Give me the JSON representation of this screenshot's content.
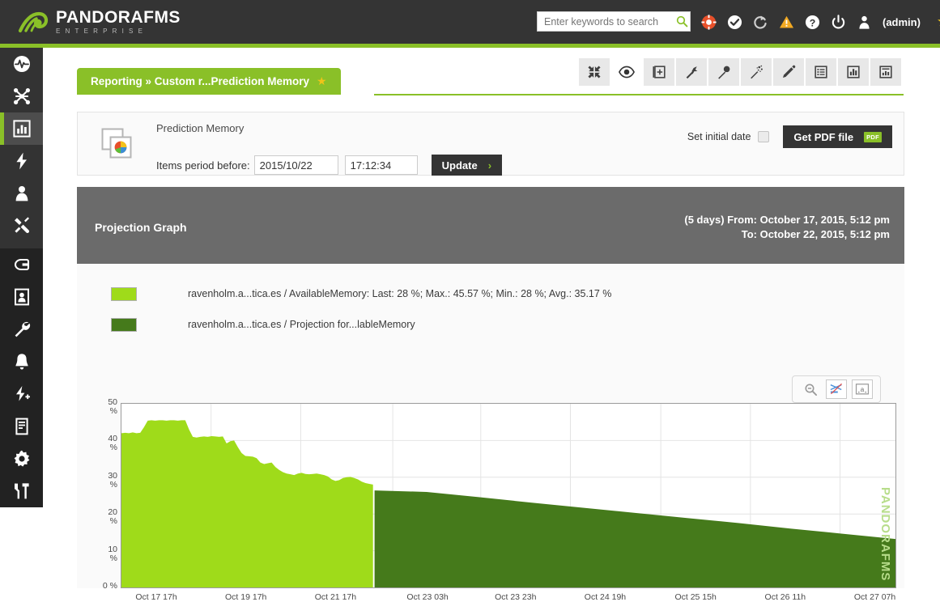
{
  "header": {
    "logo_title": "PANDORAFMS",
    "logo_sub": "ENTERPRISE",
    "logo_icon": "pandora-logo-icon",
    "search_placeholder": "Enter keywords to search",
    "search_value": "",
    "search_icon": "search-icon",
    "icons": [
      {
        "name": "lifebuoy-icon",
        "color": "#e8502a"
      },
      {
        "name": "check-circle-icon",
        "color": "#ffffff"
      },
      {
        "name": "refresh-icon",
        "color": "#cfcfcf"
      },
      {
        "name": "warning-triangle-icon",
        "color": "#f2a922"
      },
      {
        "name": "help-circle-icon",
        "color": "#ffffff"
      },
      {
        "name": "power-icon",
        "color": "#ffffff"
      },
      {
        "name": "user-icon",
        "color": "#ffffff"
      }
    ],
    "admin_label": "(admin)",
    "star_icon": "star-icon",
    "accent_color": "#8ac028"
  },
  "sidebar": {
    "items": [
      {
        "name": "sidebar-item-monitoring",
        "icon": "pulse-circle-icon",
        "active": false
      },
      {
        "name": "sidebar-item-topology",
        "icon": "network-topology-icon",
        "active": false
      },
      {
        "name": "sidebar-item-reporting",
        "icon": "bar-chart-icon",
        "active": true
      },
      {
        "name": "sidebar-item-events",
        "icon": "lightning-bolt-icon",
        "active": false
      },
      {
        "name": "sidebar-item-users",
        "icon": "user-icon",
        "active": false
      },
      {
        "name": "sidebar-item-tools",
        "icon": "tools-icon",
        "active": false
      },
      {
        "name": "sidebar-item-discovery",
        "icon": "plug-icon",
        "active": false
      },
      {
        "name": "sidebar-item-resources",
        "icon": "id-card-icon",
        "active": false
      },
      {
        "name": "sidebar-item-configuration",
        "icon": "wrench-icon",
        "active": false
      },
      {
        "name": "sidebar-item-alerts",
        "icon": "bell-icon",
        "active": false
      },
      {
        "name": "sidebar-item-events-manage",
        "icon": "lightning-plus-icon",
        "active": false
      },
      {
        "name": "sidebar-item-servers",
        "icon": "server-icon",
        "active": false
      },
      {
        "name": "sidebar-item-setup",
        "icon": "gear-icon",
        "active": false
      },
      {
        "name": "sidebar-item-admin-tools",
        "icon": "hammer-tools-icon",
        "active": false
      }
    ]
  },
  "breadcrumb": {
    "text": "Reporting » Custom r...Prediction Memory",
    "star_icon": "star-icon"
  },
  "toolbar": {
    "buttons": [
      {
        "name": "tb-fullscreen",
        "icon": "collapse-arrows-icon",
        "active": false
      },
      {
        "name": "tb-view",
        "icon": "eye-icon",
        "active": true
      },
      {
        "name": "tb-add-item",
        "icon": "add-box-icon",
        "active": false
      },
      {
        "name": "tb-wand",
        "icon": "wand-icon",
        "active": false
      },
      {
        "name": "tb-pin",
        "icon": "magnifier-pin-icon",
        "active": false
      },
      {
        "name": "tb-sparkle-wand",
        "icon": "sparkle-wand-icon",
        "active": false
      },
      {
        "name": "tb-edit",
        "icon": "pencil-icon",
        "active": false
      },
      {
        "name": "tb-list",
        "icon": "list-icon",
        "active": false
      },
      {
        "name": "tb-graph",
        "icon": "bar-chart-icon",
        "active": false
      },
      {
        "name": "tb-report",
        "icon": "chart-box-icon",
        "active": false
      }
    ]
  },
  "card": {
    "icon": "report-pie-icon",
    "title": "Prediction Memory",
    "period_label": "Items period before:",
    "date_value": "2015/10/22",
    "date_placeholder": "YYYY/MM/DD",
    "time_value": "17:12:34",
    "time_placeholder": "hh:mm:ss",
    "update_label": "Update",
    "update_chevron": "›",
    "set_initial_date_label": "Set initial date",
    "set_initial_date_checked": false,
    "get_pdf_label": "Get PDF file",
    "pdf_badge": "PDF"
  },
  "panel": {
    "title": "Projection Graph",
    "date_from": "(5 days) From: October 17, 2015, 5:12 pm",
    "date_to": "To: October 22, 2015, 5:12 pm"
  },
  "chart_controls": [
    {
      "name": "chart-zoom-out-button",
      "icon": "zoom-out-icon"
    },
    {
      "name": "chart-toggle-series-button",
      "icon": "crossed-lines-icon"
    },
    {
      "name": "chart-toggle-labels-button",
      "icon": "label-box-icon"
    }
  ],
  "chart_data": {
    "type": "area",
    "title": "Projection Graph",
    "xlabel": "",
    "ylabel": "%",
    "ylim": [
      0,
      50
    ],
    "grid": true,
    "legend_position": "top",
    "y_ticks": [
      {
        "value": 50,
        "label_line1": "50",
        "label_line2": "%"
      },
      {
        "value": 40,
        "label_line1": "40",
        "label_line2": "%"
      },
      {
        "value": 30,
        "label_line1": "30",
        "label_line2": "%"
      },
      {
        "value": 20,
        "label_line1": "20",
        "label_line2": "%"
      },
      {
        "value": 10,
        "label_line1": "10",
        "label_line2": "%"
      },
      {
        "value": 0,
        "label_line1": "0 %",
        "label_line2": ""
      }
    ],
    "x_ticks": [
      {
        "label": "Oct 17 17h",
        "pos": 0.0
      },
      {
        "label": "Oct 19 17h",
        "pos": 0.1158
      },
      {
        "label": "Oct 21 17h",
        "pos": 0.2316
      },
      {
        "label": "Oct 23 03h",
        "pos": 0.3505
      },
      {
        "label": "Oct 23 23h",
        "pos": 0.4642
      },
      {
        "label": "Oct 24 19h",
        "pos": 0.58
      },
      {
        "label": "Oct 25 15h",
        "pos": 0.6968
      },
      {
        "label": "Oct 26 11h",
        "pos": 0.8126
      },
      {
        "label": "Oct 27 07h",
        "pos": 0.9284
      }
    ],
    "watermark": "PANDORAFMS",
    "series": [
      {
        "name": "ravenholm.a...tica.es / AvailableMemory",
        "legend_text": "ravenholm.a...tica.es / AvailableMemory: Last: 28 %; Max.: 45.57 %; Min.: 28 %; Avg.: 35.17 %",
        "color": "#9fdb1a",
        "stats": {
          "last": "28 %",
          "max": "45.57 %",
          "min": "28 %",
          "avg": "35.17 %"
        },
        "x_range": [
          0.0,
          0.325
        ],
        "values": [
          42.0,
          42.1,
          42.0,
          42.2,
          42.0,
          42.1,
          43.6,
          45.4,
          45.5,
          45.4,
          45.5,
          45.5,
          45.4,
          45.5,
          45.5,
          45.4,
          45.5,
          45.5,
          43.0,
          41.0,
          40.8,
          41.0,
          41.1,
          41.0,
          41.2,
          41.1,
          41.0,
          41.1,
          39.2,
          39.8,
          40.0,
          38.2,
          36.6,
          35.8,
          35.7,
          35.6,
          35.2,
          34.0,
          33.6,
          33.8,
          34.0,
          32.8,
          32.0,
          31.4,
          31.0,
          30.8,
          30.6,
          31.0,
          31.2,
          30.9,
          30.8,
          30.9,
          31.0,
          30.8,
          30.6,
          30.2,
          29.4,
          29.0,
          29.2,
          29.8,
          30.0,
          30.1,
          29.8,
          29.4,
          28.8,
          28.4,
          28.2,
          28.0
        ]
      },
      {
        "name": "ravenholm.a...tica.es / Projection for...lableMemory",
        "legend_text": "ravenholm.a...tica.es / Projection for...lableMemory",
        "color": "#457a1b",
        "x_range": [
          0.327,
          1.0
        ],
        "values": [
          26.4,
          26.0,
          24.6,
          23.1,
          21.7,
          20.3,
          18.9,
          17.5,
          16.0,
          14.6,
          13.2
        ]
      }
    ]
  }
}
